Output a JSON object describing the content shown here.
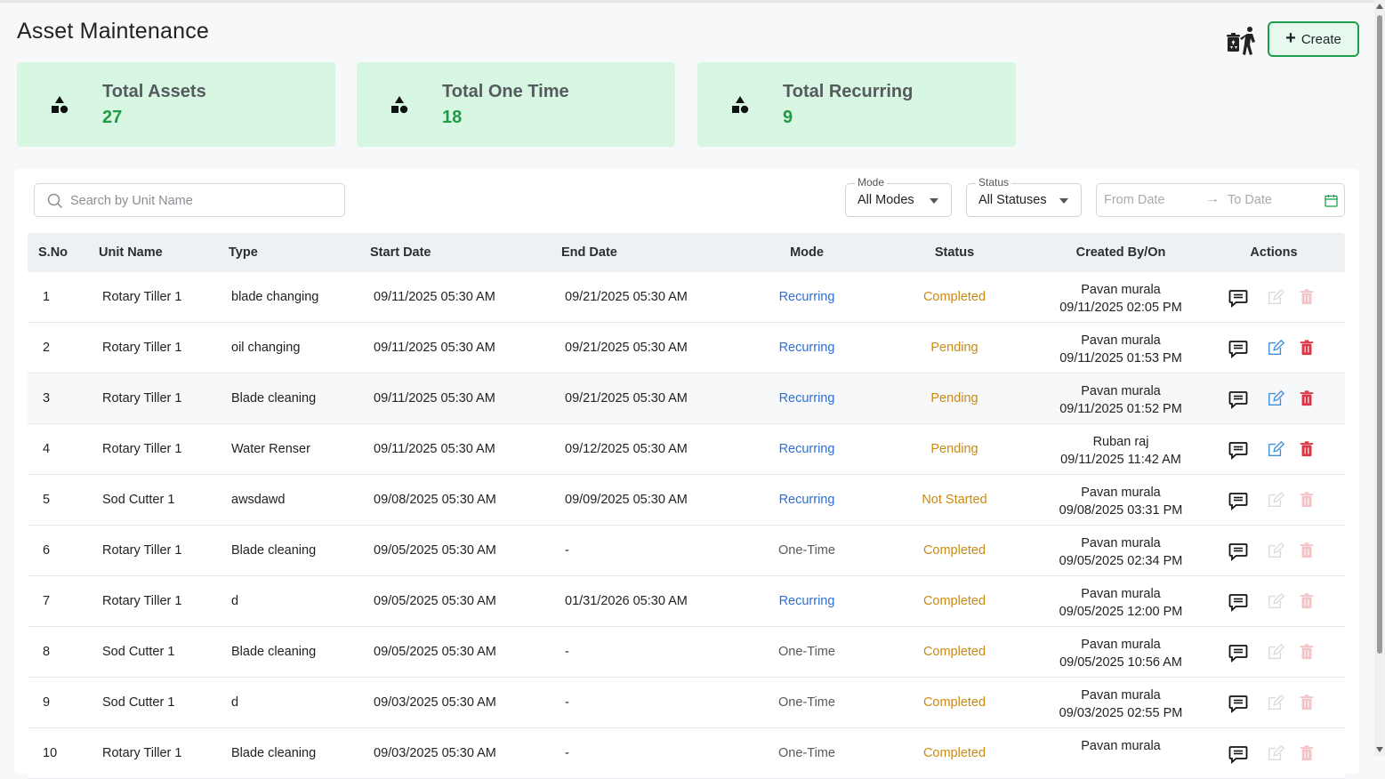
{
  "page": {
    "title": "Asset Maintenance"
  },
  "header": {
    "create_label": "Create"
  },
  "summary": [
    {
      "label": "Total Assets",
      "value": "27"
    },
    {
      "label": "Total One Time",
      "value": "18"
    },
    {
      "label": "Total Recurring",
      "value": "9"
    }
  ],
  "filters": {
    "search_placeholder": "Search by Unit Name",
    "mode": {
      "legend": "Mode",
      "value": "All Modes"
    },
    "status": {
      "legend": "Status",
      "value": "All Statuses"
    },
    "from_placeholder": "From Date",
    "to_placeholder": "To Date",
    "range_arrow": "→"
  },
  "table": {
    "headers": [
      "S.No",
      "Unit Name",
      "Type",
      "Start Date",
      "End Date",
      "Mode",
      "Status",
      "Created By/On",
      "Actions"
    ],
    "rows": [
      {
        "sno": "1",
        "unit": "Rotary Tiller 1",
        "type": "blade changing",
        "start": "09/11/2025 05:30 AM",
        "end": "09/21/2025 05:30 AM",
        "mode": "Recurring",
        "status": "Completed",
        "by": "Pavan murala",
        "on": "09/11/2025 02:05 PM",
        "editable": false
      },
      {
        "sno": "2",
        "unit": "Rotary Tiller 1",
        "type": "oil changing",
        "start": "09/11/2025 05:30 AM",
        "end": "09/21/2025 05:30 AM",
        "mode": "Recurring",
        "status": "Pending",
        "by": "Pavan murala",
        "on": "09/11/2025 01:53 PM",
        "editable": true
      },
      {
        "sno": "3",
        "unit": "Rotary Tiller 1",
        "type": "Blade cleaning",
        "start": "09/11/2025 05:30 AM",
        "end": "09/21/2025 05:30 AM",
        "mode": "Recurring",
        "status": "Pending",
        "by": "Pavan murala",
        "on": "09/11/2025 01:52 PM",
        "editable": true
      },
      {
        "sno": "4",
        "unit": "Rotary Tiller 1",
        "type": "Water Renser",
        "start": "09/11/2025 05:30 AM",
        "end": "09/12/2025 05:30 AM",
        "mode": "Recurring",
        "status": "Pending",
        "by": "Ruban raj",
        "on": "09/11/2025 11:42 AM",
        "editable": true
      },
      {
        "sno": "5",
        "unit": "Sod Cutter 1",
        "type": "awsdawd",
        "start": "09/08/2025 05:30 AM",
        "end": "09/09/2025 05:30 AM",
        "mode": "Recurring",
        "status": "Not Started",
        "by": "Pavan murala",
        "on": "09/08/2025 03:31 PM",
        "editable": false
      },
      {
        "sno": "6",
        "unit": "Rotary Tiller 1",
        "type": "Blade cleaning",
        "start": "09/05/2025 05:30 AM",
        "end": "-",
        "mode": "One-Time",
        "status": "Completed",
        "by": "Pavan murala",
        "on": "09/05/2025 02:34 PM",
        "editable": false
      },
      {
        "sno": "7",
        "unit": "Rotary Tiller 1",
        "type": "d",
        "start": "09/05/2025 05:30 AM",
        "end": "01/31/2026 05:30 AM",
        "mode": "Recurring",
        "status": "Completed",
        "by": "Pavan murala",
        "on": "09/05/2025 12:00 PM",
        "editable": false
      },
      {
        "sno": "8",
        "unit": "Sod Cutter 1",
        "type": "Blade cleaning",
        "start": "09/05/2025 05:30 AM",
        "end": "-",
        "mode": "One-Time",
        "status": "Completed",
        "by": "Pavan murala",
        "on": "09/05/2025 10:56 AM",
        "editable": false
      },
      {
        "sno": "9",
        "unit": "Sod Cutter 1",
        "type": "d",
        "start": "09/03/2025 05:30 AM",
        "end": "-",
        "mode": "One-Time",
        "status": "Completed",
        "by": "Pavan murala",
        "on": "09/03/2025 02:55 PM",
        "editable": false
      },
      {
        "sno": "10",
        "unit": "Rotary Tiller 1",
        "type": "Blade cleaning",
        "start": "09/03/2025 05:30 AM",
        "end": "-",
        "mode": "One-Time",
        "status": "Completed",
        "by": "Pavan murala",
        "on": "",
        "editable": false
      }
    ]
  },
  "icons": {
    "card": "shapes-icon",
    "comment": "comment-icon",
    "edit": "edit-icon",
    "delete": "trash-icon",
    "recycle": "recycle-person-icon",
    "calendar": "calendar-icon",
    "search": "search-icon"
  },
  "colors": {
    "accent_green": "#1f9a45",
    "card_bg": "#d7f7e3",
    "recurring": "#2f6fd6",
    "status": "#c98a14",
    "edit_blue": "#3b8fdc",
    "delete_red": "#dc3545"
  }
}
